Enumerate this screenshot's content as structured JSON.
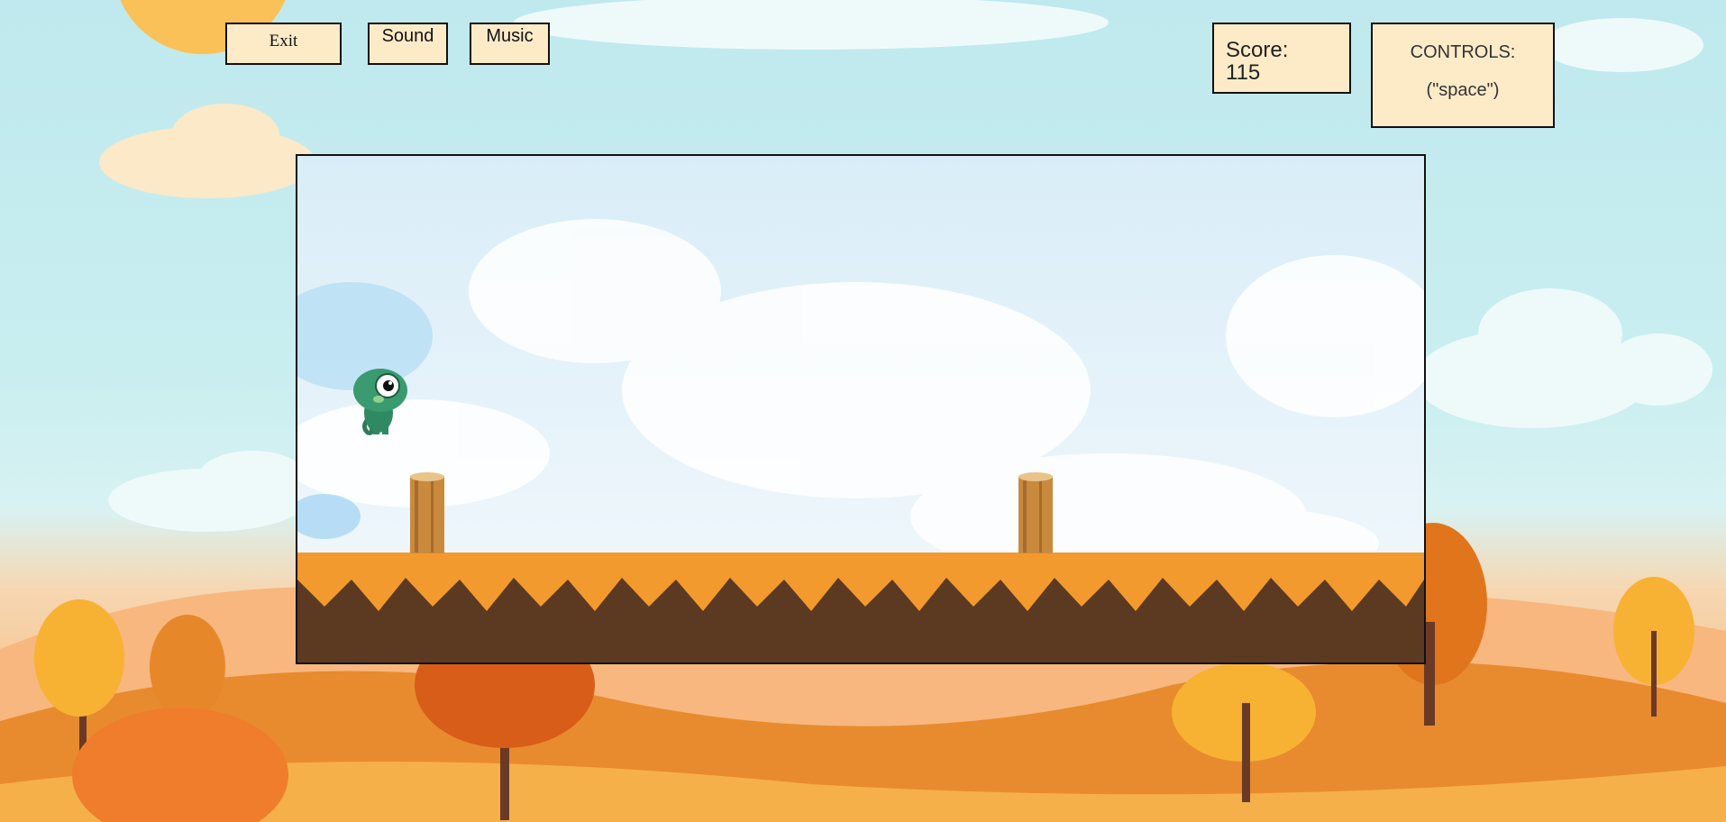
{
  "toolbar": {
    "exit_label": "Exit",
    "sound_label": "Sound",
    "music_label": "Music"
  },
  "score": {
    "label": "Score:",
    "value": "115"
  },
  "controls": {
    "title": "CONTROLS:",
    "key": "(\"space\")"
  },
  "game": {
    "player": "chameleon-character",
    "obstacles": [
      "log-stump",
      "log-stump"
    ]
  },
  "colors": {
    "panel_bg": "#fdebc8",
    "ground_orange": "#f39a2e",
    "ground_dirt": "#5c3a22",
    "sky": "#c9eef0"
  }
}
